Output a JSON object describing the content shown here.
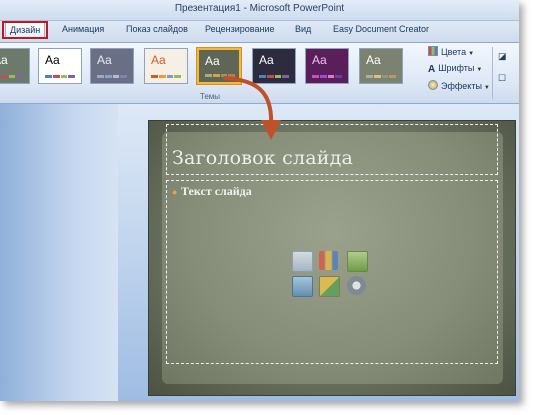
{
  "window": {
    "title": "Презентация1 - Microsoft PowerPoint"
  },
  "tabs": [
    {
      "label": "Дизайн",
      "active": true
    },
    {
      "label": "Анимация"
    },
    {
      "label": "Показ слайдов"
    },
    {
      "label": "Рецензирование"
    },
    {
      "label": "Вид"
    },
    {
      "label": "Easy Document Creator"
    }
  ],
  "ribbon": {
    "group_label": "Темы",
    "themes": [
      {
        "label": "Aa",
        "bg": "#6b7a6a",
        "fg": "#ffffff",
        "colors": [
          "#4f81bd",
          "#c0504d",
          "#9bbb59",
          "#8064a2"
        ]
      },
      {
        "label": "Aa",
        "bg": "#ffffff",
        "fg": "#000000",
        "colors": [
          "#4f81bd",
          "#c0504d",
          "#9bbb59",
          "#8064a2"
        ]
      },
      {
        "label": "Aa",
        "bg": "#6a6f86",
        "fg": "#e8e8f0",
        "colors": [
          "#a0a4c4",
          "#8ca0c8",
          "#b4bcd4",
          "#7c86ac"
        ]
      },
      {
        "label": "Aa",
        "bg": "#f6efe6",
        "fg": "#d35b26",
        "colors": [
          "#d35b26",
          "#f29a3a",
          "#7f9fb7",
          "#9ab75a"
        ]
      },
      {
        "label": "Aa",
        "bg": "#5f6656",
        "fg": "#ffffff",
        "colors": [
          "#a5ab83",
          "#d5a44a",
          "#8c9a6e",
          "#b77c54"
        ],
        "selected": true
      },
      {
        "label": "Aa",
        "bg": "#2c2c3e",
        "fg": "#ffffff",
        "colors": [
          "#4f81bd",
          "#c0504d",
          "#9bbb59",
          "#8064a2"
        ]
      },
      {
        "label": "Aa",
        "bg": "#5a1f5a",
        "fg": "#f0c0f0",
        "colors": [
          "#d04fb0",
          "#9b4fd0",
          "#e07ab8",
          "#6a3fa8"
        ]
      },
      {
        "label": "Aa",
        "bg": "#7b8270",
        "fg": "#ffffff",
        "colors": [
          "#a8b28c",
          "#d8c27a",
          "#8e9a78",
          "#c0956a"
        ]
      }
    ],
    "commands": {
      "colors": "Цвета",
      "fonts": "Шрифты",
      "effects": "Эффекты"
    }
  },
  "slide": {
    "title": "Заголовок слайда",
    "body": "Текст слайда"
  },
  "colors": {
    "highlight": "#c0181e",
    "arrow": "#c0502a",
    "selected_theme_border": "#f2b93a"
  }
}
